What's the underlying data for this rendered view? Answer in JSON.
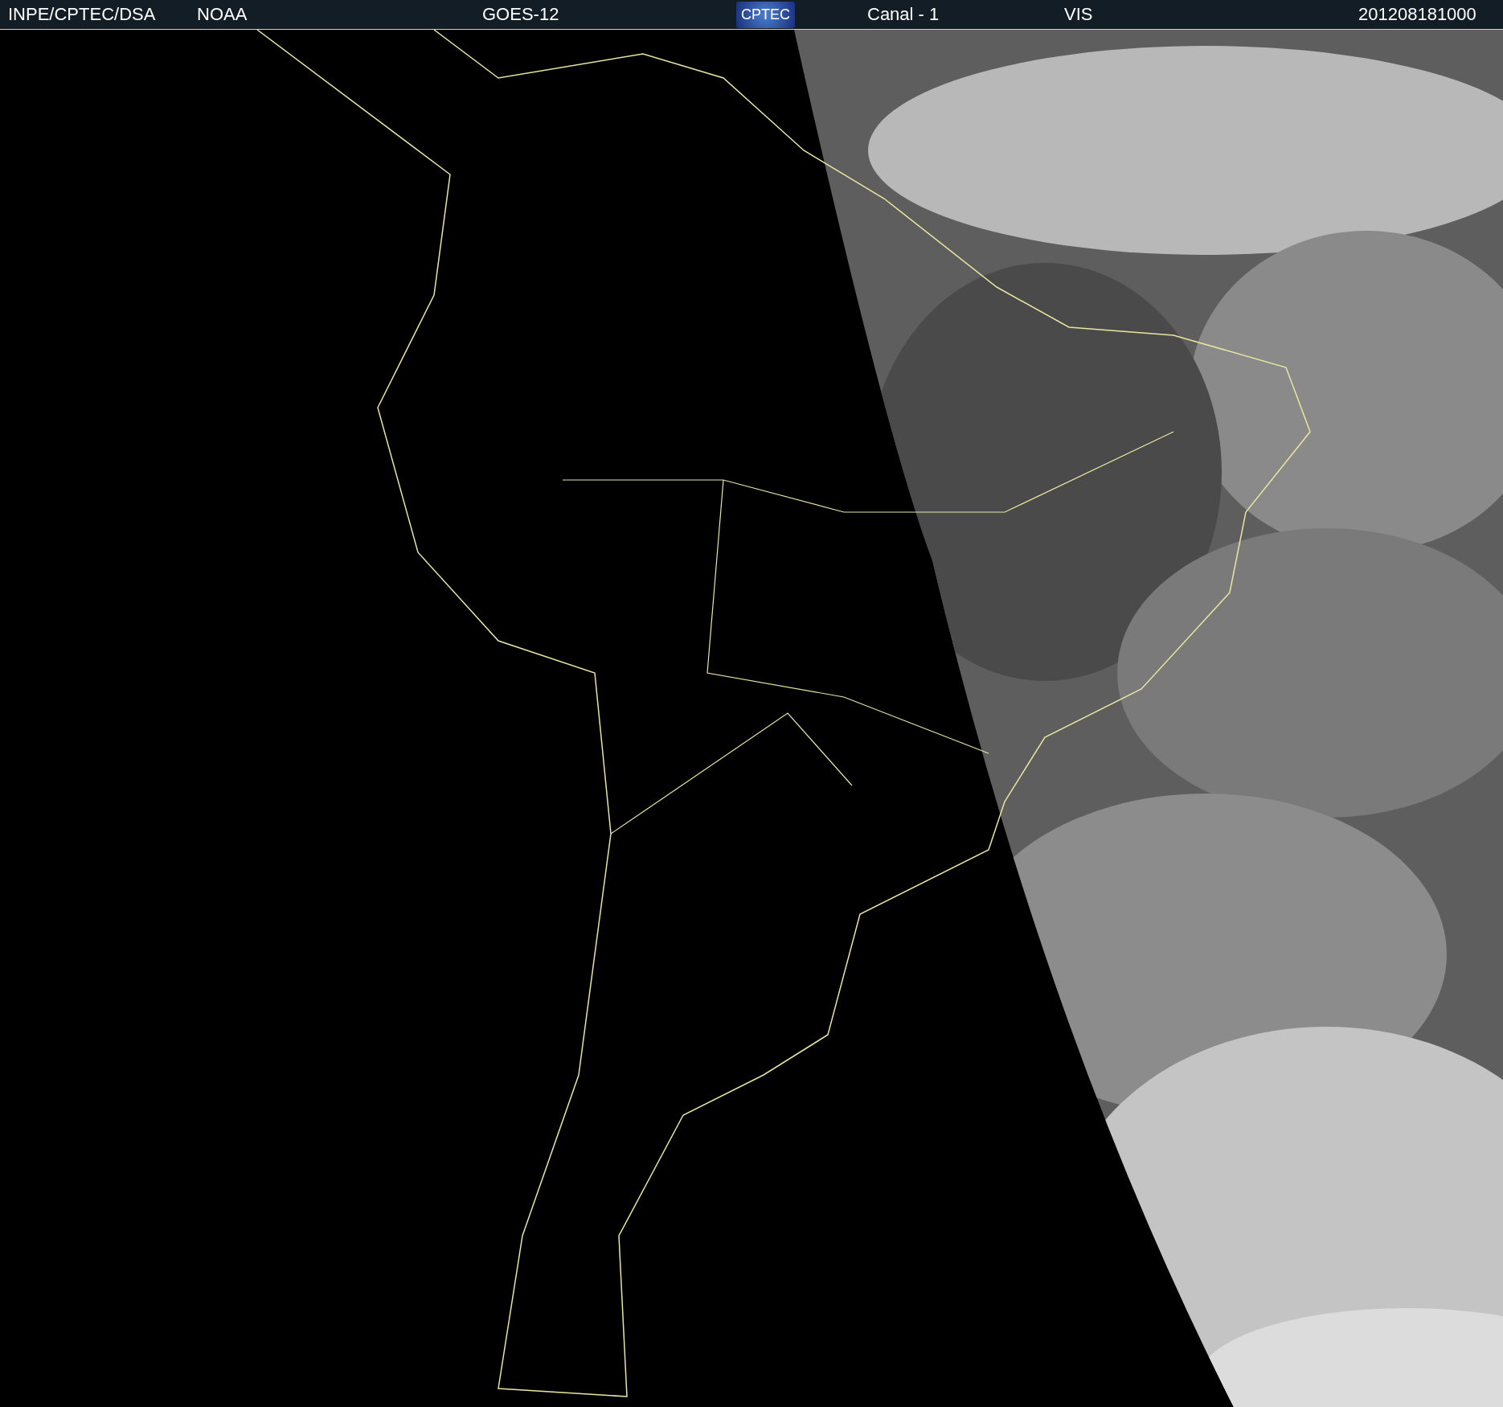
{
  "header": {
    "source": "INPE/CPTEC/DSA",
    "agency": "NOAA",
    "satellite": "GOES-12",
    "logo": "CPTEC",
    "channel": "Canal - 1",
    "band": "VIS",
    "timestamp": "201208181000"
  }
}
